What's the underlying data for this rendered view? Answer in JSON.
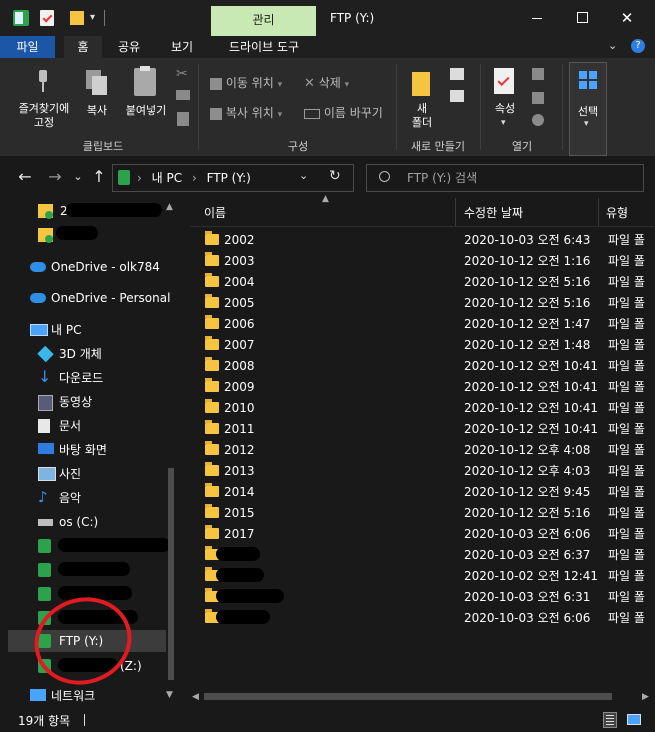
{
  "window": {
    "title": "FTP (Y:)",
    "context_tab": "관리",
    "colors": {
      "accent": "#c8e8b4",
      "accent_text": "#1f1f1f",
      "selected": "#3c3c3c",
      "redact": "#000000",
      "annotation": "#e11b22"
    }
  },
  "ribbon_tabs": [
    "파일",
    "홈",
    "공유",
    "보기",
    "드라이브 도구"
  ],
  "ribbon": {
    "clipboard": {
      "pin": "즐겨찾기에\n고정",
      "copy": "복사",
      "paste": "붙여넣기",
      "label": "클립보드"
    },
    "organize": {
      "move": "이동 위치",
      "copy_to": "복사 위치",
      "delete": "삭제",
      "rename": "이름 바꾸기",
      "label": "구성"
    },
    "new": {
      "new_folder": "새\n폴더",
      "label": "새로 만들기"
    },
    "open": {
      "properties": "속성",
      "label": "열기"
    },
    "select": {
      "select": "선택"
    }
  },
  "address": {
    "segments": [
      "내 PC",
      "FTP (Y:)"
    ],
    "search_placeholder": "FTP (Y:) 검색"
  },
  "sidebar": {
    "items": [
      {
        "label": "2",
        "icon": "folder-pin-icon"
      },
      {
        "label": "",
        "icon": "folder-pin-icon"
      },
      {
        "label": "OneDrive - olk784",
        "icon": "onedrive-icon"
      },
      {
        "label": "OneDrive - Personal",
        "icon": "onedrive-icon"
      },
      {
        "label": "내 PC",
        "icon": "pc-icon"
      },
      {
        "label": "3D 개체",
        "icon": "3d-objects-icon"
      },
      {
        "label": "다운로드",
        "icon": "download-icon"
      },
      {
        "label": "동영상",
        "icon": "video-icon"
      },
      {
        "label": "문서",
        "icon": "document-icon"
      },
      {
        "label": "바탕 화면",
        "icon": "desktop-icon"
      },
      {
        "label": "사진",
        "icon": "pictures-icon"
      },
      {
        "label": "음악",
        "icon": "music-icon"
      },
      {
        "label": "os (C:)",
        "icon": "drive-icon"
      },
      {
        "label": "",
        "icon": "network-drive-icon"
      },
      {
        "label": "",
        "icon": "network-drive-icon"
      },
      {
        "label": "",
        "icon": "network-drive-icon"
      },
      {
        "label": "",
        "icon": "network-drive-icon"
      },
      {
        "label": "FTP (Y:)",
        "icon": "network-drive-icon"
      },
      {
        "label": "(Z:)",
        "icon": "network-drive-icon"
      },
      {
        "label": "네트워크",
        "icon": "network-icon"
      }
    ]
  },
  "columns": {
    "name": "이름",
    "modified": "수정한 날짜",
    "type": "유형"
  },
  "rows": [
    {
      "name": "2002",
      "date": "2020-10-03 오전 6:43",
      "type": "파일 폴"
    },
    {
      "name": "2003",
      "date": "2020-10-12 오전 1:16",
      "type": "파일 폴"
    },
    {
      "name": "2004",
      "date": "2020-10-12 오전 5:16",
      "type": "파일 폴"
    },
    {
      "name": "2005",
      "date": "2020-10-12 오전 5:16",
      "type": "파일 폴"
    },
    {
      "name": "2006",
      "date": "2020-10-12 오전 1:47",
      "type": "파일 폴"
    },
    {
      "name": "2007",
      "date": "2020-10-12 오전 1:48",
      "type": "파일 폴"
    },
    {
      "name": "2008",
      "date": "2020-10-12 오전 10:41",
      "type": "파일 폴"
    },
    {
      "name": "2009",
      "date": "2020-10-12 오전 10:41",
      "type": "파일 폴"
    },
    {
      "name": "2010",
      "date": "2020-10-12 오전 10:41",
      "type": "파일 폴"
    },
    {
      "name": "2011",
      "date": "2020-10-12 오전 10:41",
      "type": "파일 폴"
    },
    {
      "name": "2012",
      "date": "2020-10-12 오후 4:08",
      "type": "파일 폴"
    },
    {
      "name": "2013",
      "date": "2020-10-12 오후 4:03",
      "type": "파일 폴"
    },
    {
      "name": "2014",
      "date": "2020-10-12 오전 9:45",
      "type": "파일 폴"
    },
    {
      "name": "2015",
      "date": "2020-10-12 오전 5:16",
      "type": "파일 폴"
    },
    {
      "name": "2017",
      "date": "2020-10-03 오전 6:06",
      "type": "파일 폴"
    },
    {
      "name": "",
      "date": "2020-10-03 오전 6:37",
      "type": "파일 폴"
    },
    {
      "name": "",
      "date": "2020-10-02 오전 12:41",
      "type": "파일 폴"
    },
    {
      "name": "",
      "date": "2020-10-03 오전 6:31",
      "type": "파일 폴"
    },
    {
      "name": "",
      "date": "2020-10-03 오전 6:06",
      "type": "파일 폴"
    }
  ],
  "status": {
    "count": "19개 항목"
  }
}
